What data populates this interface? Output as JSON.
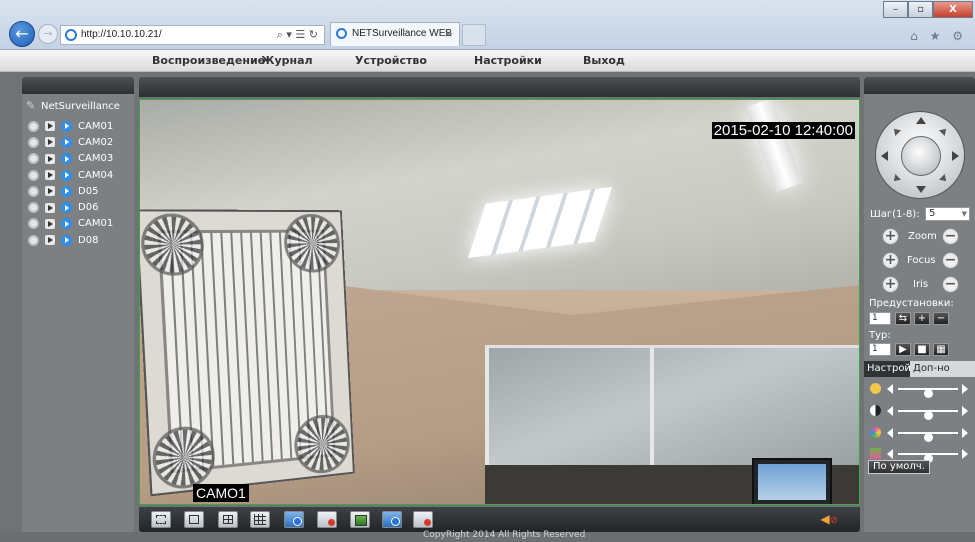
{
  "browser": {
    "url": "http://10.10.10.21/",
    "tab_title": "NETSurveillance WEB",
    "tab_close": "×",
    "window_controls": [
      "–",
      "▫",
      "X"
    ],
    "toolbar_icons": "⌂ ★ ⚙"
  },
  "menu": {
    "items": [
      "Воспроизведение",
      "Журнал",
      "Устройство",
      "Настройки",
      "Выход"
    ]
  },
  "sidebar": {
    "root_label": "NetSurveillance",
    "cameras": [
      "CAM01",
      "CAM02",
      "CAM03",
      "CAM04",
      "D05",
      "D06",
      "CAM01",
      "D08"
    ]
  },
  "video": {
    "timestamp": "2015-02-10 12:40:00",
    "camera_label": "CAMO1"
  },
  "bottom_toolbar": {
    "buttons": [
      "fullscreen",
      "single-view",
      "quad-view",
      "nine-view",
      "record",
      "stop-record",
      "snapshot",
      "talk",
      "stop-talk"
    ],
    "mute_icon": "speaker-muted-icon"
  },
  "ptz": {
    "step_label": "Шаг(1-8):",
    "step_value": "5",
    "zoom_label": "Zoom",
    "focus_label": "Focus",
    "iris_label": "Iris",
    "plus": "+",
    "minus": "−",
    "presets_label": "Предустановки:",
    "preset_value": "1",
    "tour_label": "Тур:",
    "tour_value": "1"
  },
  "image_settings": {
    "tab_settings": "Настройки",
    "tab_extra": "Доп-но",
    "sliders": [
      {
        "name": "brightness",
        "value": 0.5,
        "color": "#f2c94c"
      },
      {
        "name": "contrast",
        "value": 0.5,
        "color": "#ffffff"
      },
      {
        "name": "saturation",
        "value": 0.5,
        "color": "#e45a9c"
      },
      {
        "name": "hue",
        "value": 0.5,
        "color": "#6fb34a"
      }
    ],
    "default_button": "По умолч."
  },
  "footer": {
    "copyright": "CopyRight 2014 All Rights Reserved"
  }
}
